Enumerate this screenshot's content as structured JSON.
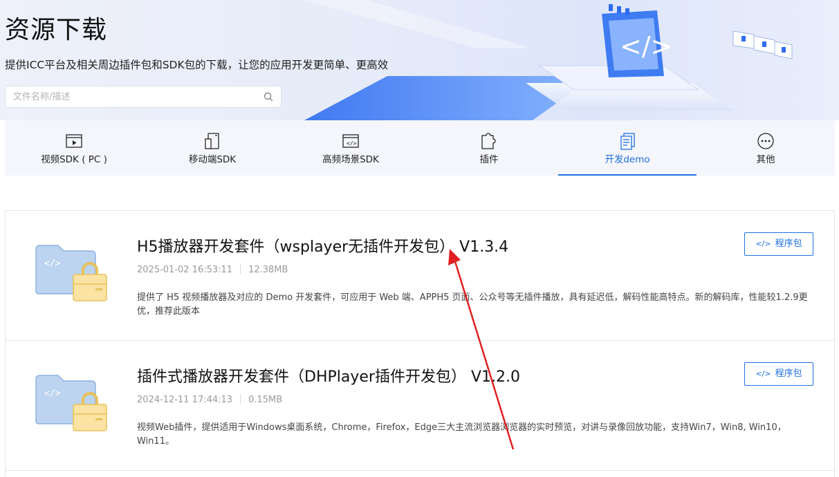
{
  "header": {
    "title": "资源下载",
    "subtitle": "提供ICC平台及相关周边插件包和SDK包的下载，让您的应用开发更简单、更高效",
    "search_placeholder": "文件名称/描述"
  },
  "tabs": [
    {
      "label": "视频SDK ( PC )",
      "icon": "video-player-icon"
    },
    {
      "label": "移动端SDK",
      "icon": "mobile-icon"
    },
    {
      "label": "高频场景SDK",
      "icon": "code-window-icon"
    },
    {
      "label": "插件",
      "icon": "plugin-icon"
    },
    {
      "label": "开发demo",
      "icon": "document-icon",
      "active": true
    },
    {
      "label": "其他",
      "icon": "more-icon"
    }
  ],
  "items": [
    {
      "title": "H5播放器开发套件（wsplayer无插件开发包） V1.3.4",
      "date": "2025-01-02 16:53:11",
      "size": "12.38MB",
      "description": "提供了 H5 视频播放器及对应的 Demo 开发套件，可应用于 Web 端、APPH5 页面、公众号等无插件播放，具有延迟低，解码性能高特点。新的解码库，性能较1.2.9更优，推荐此版本",
      "button_label": "程序包"
    },
    {
      "title": "插件式播放器开发套件（DHPlayer插件开发包） V1.2.0",
      "date": "2024-12-11 17:44:13",
      "size": "0.15MB",
      "description": "视频Web插件，提供适用于Windows桌面系统，Chrome，Firefox，Edge三大主流浏览器浏览器的实时预览，对讲与录像回放功能，支持Win7，Win8, Win10，Win11。",
      "button_label": "程序包"
    }
  ],
  "colors": {
    "accent": "#1f6fe5",
    "annotation_arrow": "#e02020"
  }
}
